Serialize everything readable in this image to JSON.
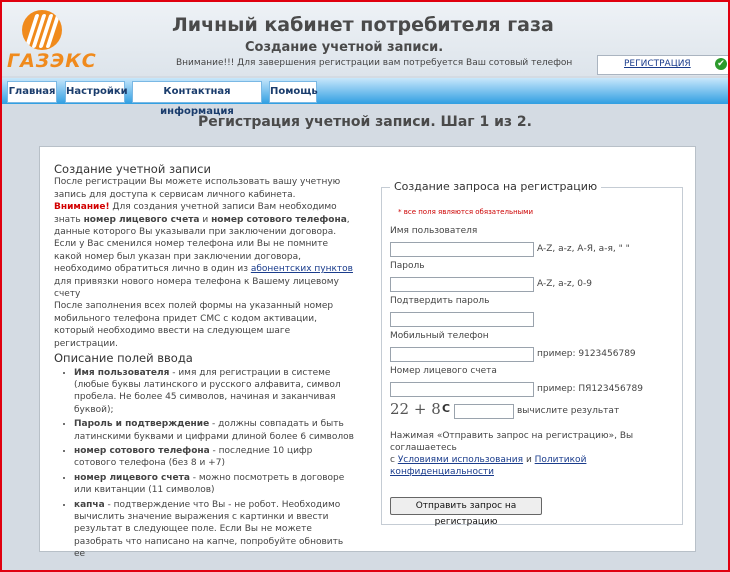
{
  "header": {
    "logo_text": "ГАЗЭКС",
    "title": "Личный кабинет потребителя газа",
    "subtitle": "Создание учетной записи.",
    "notice": "Внимание!!! Для завершения регистрации вам потребуется Ваш сотовый телефон",
    "reg_tab": "РЕГИСТРАЦИЯ"
  },
  "nav": [
    "Главная",
    "Настройки",
    "Контактная информация",
    "Помощь"
  ],
  "page_heading": "Регистрация учетной записи. Шаг 1 из 2.",
  "info": {
    "heading": "Создание учетной записи",
    "p1": "После регистрации Вы можете использовать вашу учетную запись для доступа к сервисам личного кабинета.",
    "warn": "Внимание!",
    "p2_a": " Для создания учетной записи Вам необходимо знать ",
    "p2_b": "номер лицевого счета",
    "p2_c": " и ",
    "p2_d": "номер сотового телефона",
    "p2_e": ", данные которого Вы указывали при заключении договора.",
    "p3_a": "Если у Вас сменился номер телефона или Вы не помните какой номер был указан при заключении договора, необходимо обратиться лично в один из ",
    "p3_link": "абонентских пунктов",
    "p3_b": " для привязки нового номера телефона к Вашему лицевому счету",
    "p4": "После заполнения всех полей формы на указанный номер мобильного телефона придет СМС с кодом активации, который необходимо ввести на следующем шаге регистрации.",
    "fields_heading": "Описание полей ввода",
    "fields": [
      {
        "name": "Имя пользователя",
        "desc": " - имя для регистрации в системе (любые буквы латинского и русского алфавита, символ пробела. Не более 45 символов, начиная и заканчивая буквой);"
      },
      {
        "name": "Пароль и подтверждение",
        "desc": " - должны совпадать и быть латинскими буквами и цифрами длиной более 6 символов"
      },
      {
        "name": "номер сотового телефона",
        "desc": " - последние 10 цифр сотового телефона (без 8 и +7)"
      },
      {
        "name": "номер лицевого счета",
        "desc": " - можно посмотреть в договоре или квитанции (11 символов)"
      },
      {
        "name": "капча",
        "desc": " - подтверждение что Вы - не робот. Необходимо вычислить значение выражения с картинки и ввести результат в следующее поле. Если Вы не можете разобрать что написано на капче, попробуйте обновить ее"
      }
    ]
  },
  "form": {
    "legend": "Создание запроса на регистрацию",
    "required_note": "* все поля являются обязательными",
    "username_label": "Имя пользователя",
    "username_hint": "A-Z, a-z, А-Я, а-я, \" \"",
    "password_label": "Пароль",
    "password_hint": "A-Z, a-z, 0-9",
    "confirm_label": "Подтвердить пароль",
    "phone_label": "Мобильный телефон",
    "phone_hint": "пример: 9123456789",
    "account_label": "Номер лицевого счета",
    "account_hint": "пример: ПЯ123456789",
    "captcha_text": "22 + 8",
    "captcha_hint": "вычислите результат",
    "agree_a": "Нажимая «Отправить запрос на регистрацию», Вы соглашаетесь",
    "agree_b": "с ",
    "terms_link": "Условиями использования",
    "agree_c": " и ",
    "privacy_link": "Политикой конфиденциальности",
    "submit": "Отправить запрос на регистрацию"
  }
}
